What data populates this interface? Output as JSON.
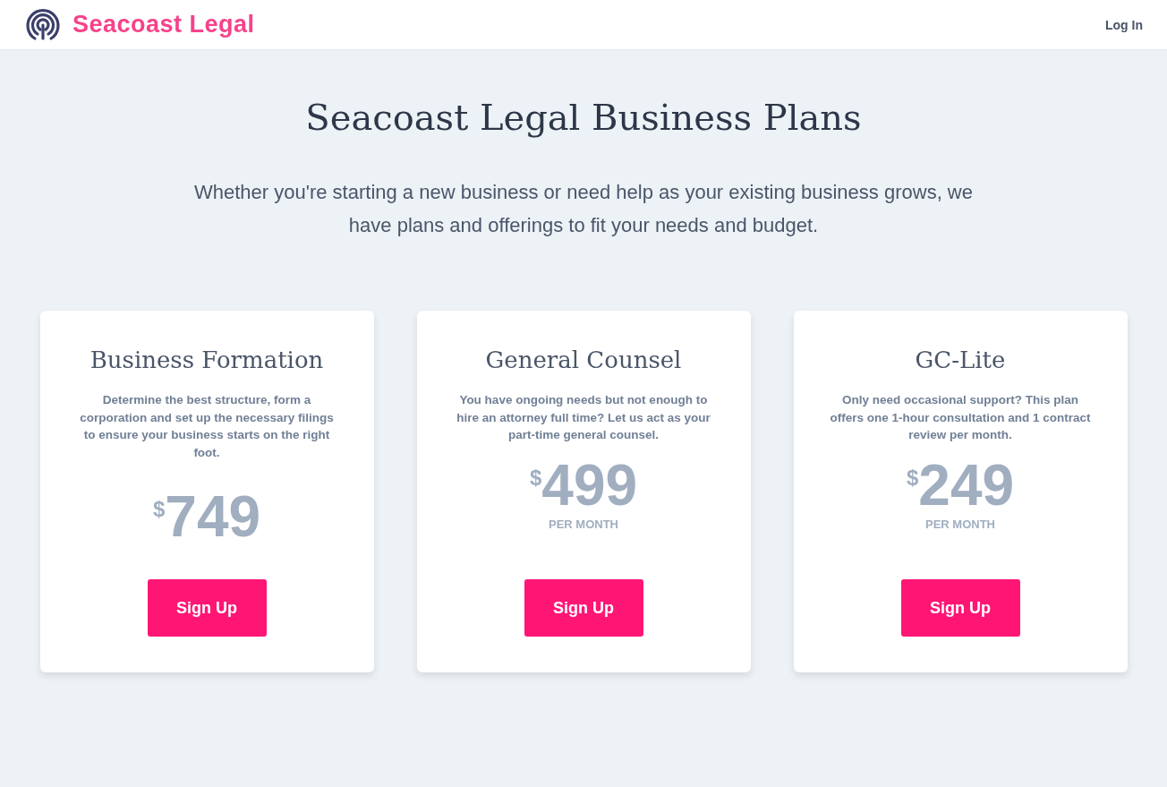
{
  "header": {
    "brand": "Seacoast Legal",
    "login": "Log In"
  },
  "hero": {
    "title": "Seacoast Legal Business Plans",
    "subtitle": "Whether you're starting a new business or need help as your existing business grows, we have plans and offerings to fit your needs and budget."
  },
  "plans": [
    {
      "name": "Business Formation",
      "description": "Determine the best structure, form a corporation and set up the necessary filings to ensure your business starts on the right foot.",
      "currency": "$",
      "price": "749",
      "button": "Sign Up"
    },
    {
      "name": "General Counsel",
      "description": "You have ongoing needs but not enough to hire an attorney full time? Let us act as your part-time general counsel.",
      "currency": "$",
      "price": "499",
      "period": "PER MONTH",
      "button": "Sign Up"
    },
    {
      "name": "GC-Lite",
      "description": "Only need occasional support? This plan offers one 1-hour consultation and 1 contract review per month.",
      "currency": "$",
      "price": "249",
      "period": "PER MONTH",
      "button": "Sign Up"
    }
  ]
}
